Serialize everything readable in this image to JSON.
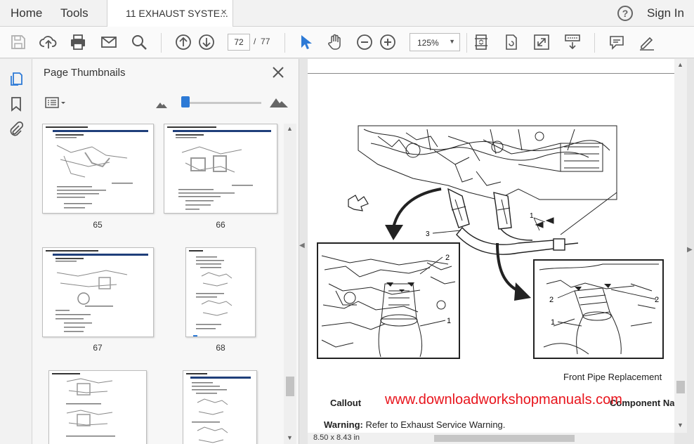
{
  "menu": {
    "home": "Home",
    "tools": "Tools",
    "sign_in": "Sign In",
    "help": "?"
  },
  "tab": {
    "title": "11 EXHAUST SYSTE...",
    "close": "×"
  },
  "toolbar": {
    "page_current": "72",
    "page_sep": "/",
    "page_total": "77",
    "zoom": "125%"
  },
  "panel": {
    "title": "Page Thumbnails",
    "thumbnails": [
      {
        "label": "65"
      },
      {
        "label": "66"
      },
      {
        "label": "67"
      },
      {
        "label": "68"
      }
    ]
  },
  "document": {
    "figure_caption": "Front Pipe Replacement",
    "table_header_callout": "Callout",
    "table_header_component": "Component Nar",
    "watermark": "www.downloadworkshopmanuals.com",
    "warning_label": "Warning:",
    "warning_text": " Refer to Exhaust Service Warning.",
    "callout_numbers": [
      "1",
      "2",
      "3",
      "1",
      "2",
      "1",
      "2",
      "2"
    ]
  },
  "status": {
    "page_size": "8.50 x 8.43 in"
  },
  "colors": {
    "accent": "#2d7ad6",
    "watermark": "#e8141c"
  }
}
